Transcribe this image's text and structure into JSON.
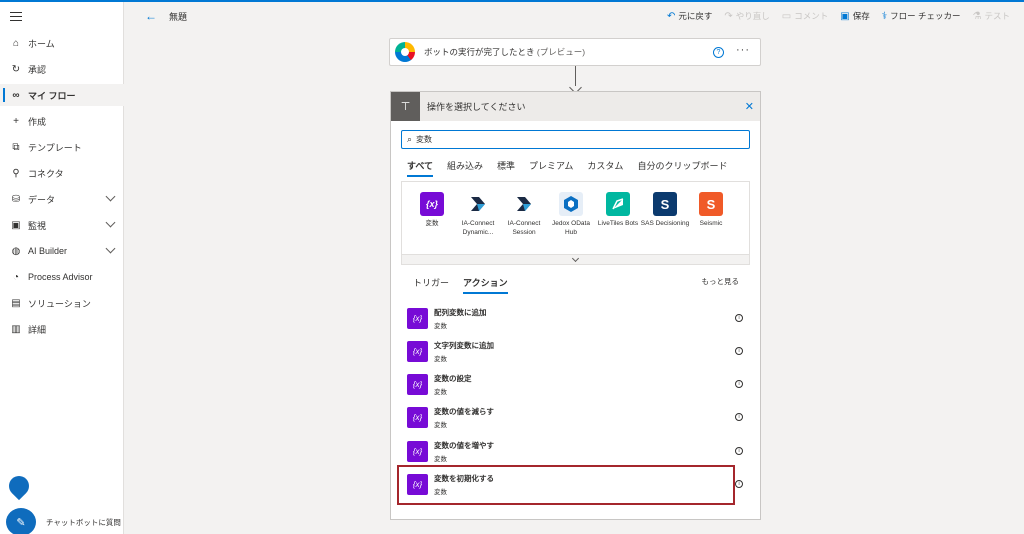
{
  "sidebar": {
    "items": [
      {
        "label": "ホーム",
        "icon": "home-icon"
      },
      {
        "label": "承認",
        "icon": "approval-icon"
      },
      {
        "label": "マイ フロー",
        "icon": "flow-icon"
      },
      {
        "label": "作成",
        "icon": "plus-icon"
      },
      {
        "label": "テンプレート",
        "icon": "template-icon"
      },
      {
        "label": "コネクタ",
        "icon": "connector-icon"
      },
      {
        "label": "データ",
        "icon": "data-icon"
      },
      {
        "label": "監視",
        "icon": "monitor-icon"
      },
      {
        "label": "AI Builder",
        "icon": "ai-builder-icon"
      },
      {
        "label": "Process Advisor",
        "icon": "process-advisor-icon"
      },
      {
        "label": "ソリューション",
        "icon": "solution-icon"
      },
      {
        "label": "詳細",
        "icon": "book-icon"
      }
    ],
    "chat_label": "チャットボットに質問"
  },
  "header": {
    "title": "無題",
    "undo": "元に戻す",
    "redo": "やり直し",
    "comment": "コメント",
    "save": "保存",
    "checker": "フロー チェッカー",
    "test": "テスト"
  },
  "trigger": {
    "title": "ボットの実行が完了したとき",
    "preview": "(プレビュー)",
    "help": "?",
    "more": "···"
  },
  "panel": {
    "title": "操作を選択してください",
    "search_value": "変数",
    "tabs": [
      "すべて",
      "組み込み",
      "標準",
      "プレミアム",
      "カスタム",
      "自分のクリップボード"
    ],
    "connectors": [
      {
        "label": "変数",
        "color": "#770bd6",
        "glyph": "{x}"
      },
      {
        "label": "IA-Connect Dynamic...",
        "color": "#ffffff",
        "glyph": ""
      },
      {
        "label": "IA-Connect Session",
        "color": "#ffffff",
        "glyph": ""
      },
      {
        "label": "Jedox OData Hub",
        "color": "#0a6fc2",
        "glyph": ""
      },
      {
        "label": "LiveTiles Bots",
        "color": "#00b7a0",
        "glyph": ""
      },
      {
        "label": "SAS Decisioning",
        "color": "#0b3a6e",
        "glyph": "S"
      },
      {
        "label": "Seismic",
        "color": "#f05a28",
        "glyph": "S"
      }
    ],
    "subtabs": [
      "トリガー",
      "アクション"
    ],
    "more_label": "もっと見る",
    "actions": [
      {
        "name": "配列変数に追加",
        "sub": "変数"
      },
      {
        "name": "文字列変数に追加",
        "sub": "変数"
      },
      {
        "name": "変数の設定",
        "sub": "変数"
      },
      {
        "name": "変数の値を減らす",
        "sub": "変数"
      },
      {
        "name": "変数の値を増やす",
        "sub": "変数"
      },
      {
        "name": "変数を初期化する",
        "sub": "変数"
      }
    ]
  }
}
